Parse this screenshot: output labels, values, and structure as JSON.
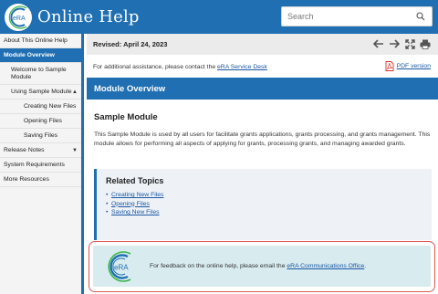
{
  "header": {
    "logo_text": "eRA",
    "title": "Online Help",
    "search_placeholder": "Search"
  },
  "sidebar": {
    "items": [
      {
        "label": "About This Online Help"
      },
      {
        "label": "Module Overview"
      },
      {
        "label": "Welcome to Sample Module"
      },
      {
        "label": "Using Sample Module"
      },
      {
        "label": "Creating New Files"
      },
      {
        "label": "Opening Files"
      },
      {
        "label": "Saving Files"
      },
      {
        "label": "Release Notes"
      },
      {
        "label": "System Requirements"
      },
      {
        "label": "More Resources"
      }
    ]
  },
  "toolbar": {
    "revised": "Revised: April 24, 2023"
  },
  "assist": {
    "prefix": "For additional assistance, please contact the ",
    "link": "eRA Service Desk",
    "pdf_link": "PDF version"
  },
  "section": {
    "header": "Module Overview",
    "subtitle": "Sample Module",
    "description": "This Sample Module is used by all users for facilitate grants applications, grants processing, and grants management. This module allows for performing all aspects of applying for grants, processing grants, and managing awarded grants."
  },
  "related": {
    "title": "Related Topics",
    "links": [
      "Creating New Files",
      "Opening Files",
      "Saving New Files"
    ]
  },
  "feedback": {
    "logo_text": "eRA",
    "prefix": "For feedback on the online help, please email the ",
    "link": "eRA Communications Office",
    "suffix": "."
  },
  "colors": {
    "brand_blue": "#1f6fb2",
    "feedback_bg": "#d8ebef",
    "highlight_outline": "#e05757",
    "pdf_red": "#d9342b"
  }
}
